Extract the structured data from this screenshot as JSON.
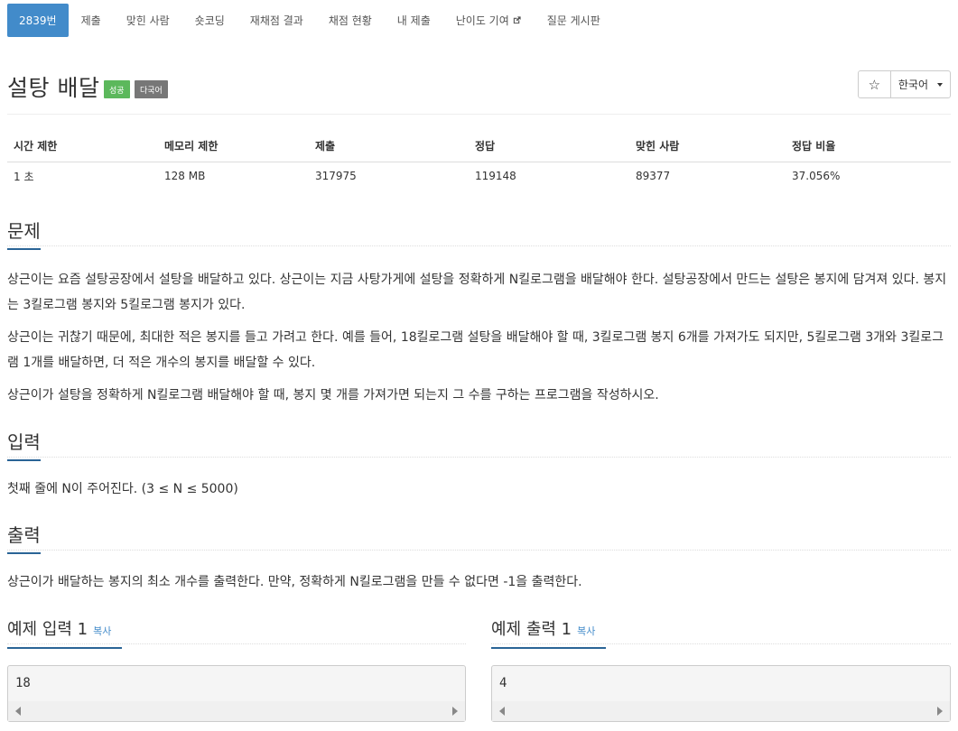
{
  "tabs": [
    {
      "label": "2839번"
    },
    {
      "label": "제출"
    },
    {
      "label": "맞힌 사람"
    },
    {
      "label": "숏코딩"
    },
    {
      "label": "재채점 결과"
    },
    {
      "label": "채점 현황"
    },
    {
      "label": "내 제출"
    },
    {
      "label": "난이도 기여"
    },
    {
      "label": "질문 게시판"
    }
  ],
  "problem": {
    "title": "설탕 배달",
    "badge_success": "성공",
    "badge_multi": "다국어",
    "star_icon": "☆",
    "language": "한국어"
  },
  "info_table": {
    "headers": [
      "시간 제한",
      "메모리 제한",
      "제출",
      "정답",
      "맞힌 사람",
      "정답 비율"
    ],
    "values": [
      "1 초",
      "128 MB",
      "317975",
      "119148",
      "89377",
      "37.056%"
    ]
  },
  "sections": {
    "problem_heading": "문제",
    "problem_p1": "상근이는 요즘 설탕공장에서 설탕을 배달하고 있다. 상근이는 지금 사탕가게에 설탕을 정확하게 N킬로그램을 배달해야 한다. 설탕공장에서 만드는 설탕은 봉지에 담겨져 있다. 봉지는 3킬로그램 봉지와 5킬로그램 봉지가 있다.",
    "problem_p2": "상근이는 귀찮기 때문에, 최대한 적은 봉지를 들고 가려고 한다. 예를 들어, 18킬로그램 설탕을 배달해야 할 때, 3킬로그램 봉지 6개를 가져가도 되지만, 5킬로그램 3개와 3킬로그램 1개를 배달하면, 더 적은 개수의 봉지를 배달할 수 있다.",
    "problem_p3": "상근이가 설탕을 정확하게 N킬로그램 배달해야 할 때, 봉지 몇 개를 가져가면 되는지 그 수를 구하는 프로그램을 작성하시오.",
    "input_heading": "입력",
    "input_text": "첫째 줄에 N이 주어진다. (3 ≤ N ≤ 5000)",
    "output_heading": "출력",
    "output_text": "상근이가 배달하는 봉지의 최소 개수를 출력한다. 만약, 정확하게 N킬로그램을 만들 수 없다면 -1을 출력한다."
  },
  "samples": {
    "input_title": "예제 입력 1",
    "output_title": "예제 출력 1",
    "copy_label": "복사",
    "input_value": "18",
    "output_value": "4"
  }
}
